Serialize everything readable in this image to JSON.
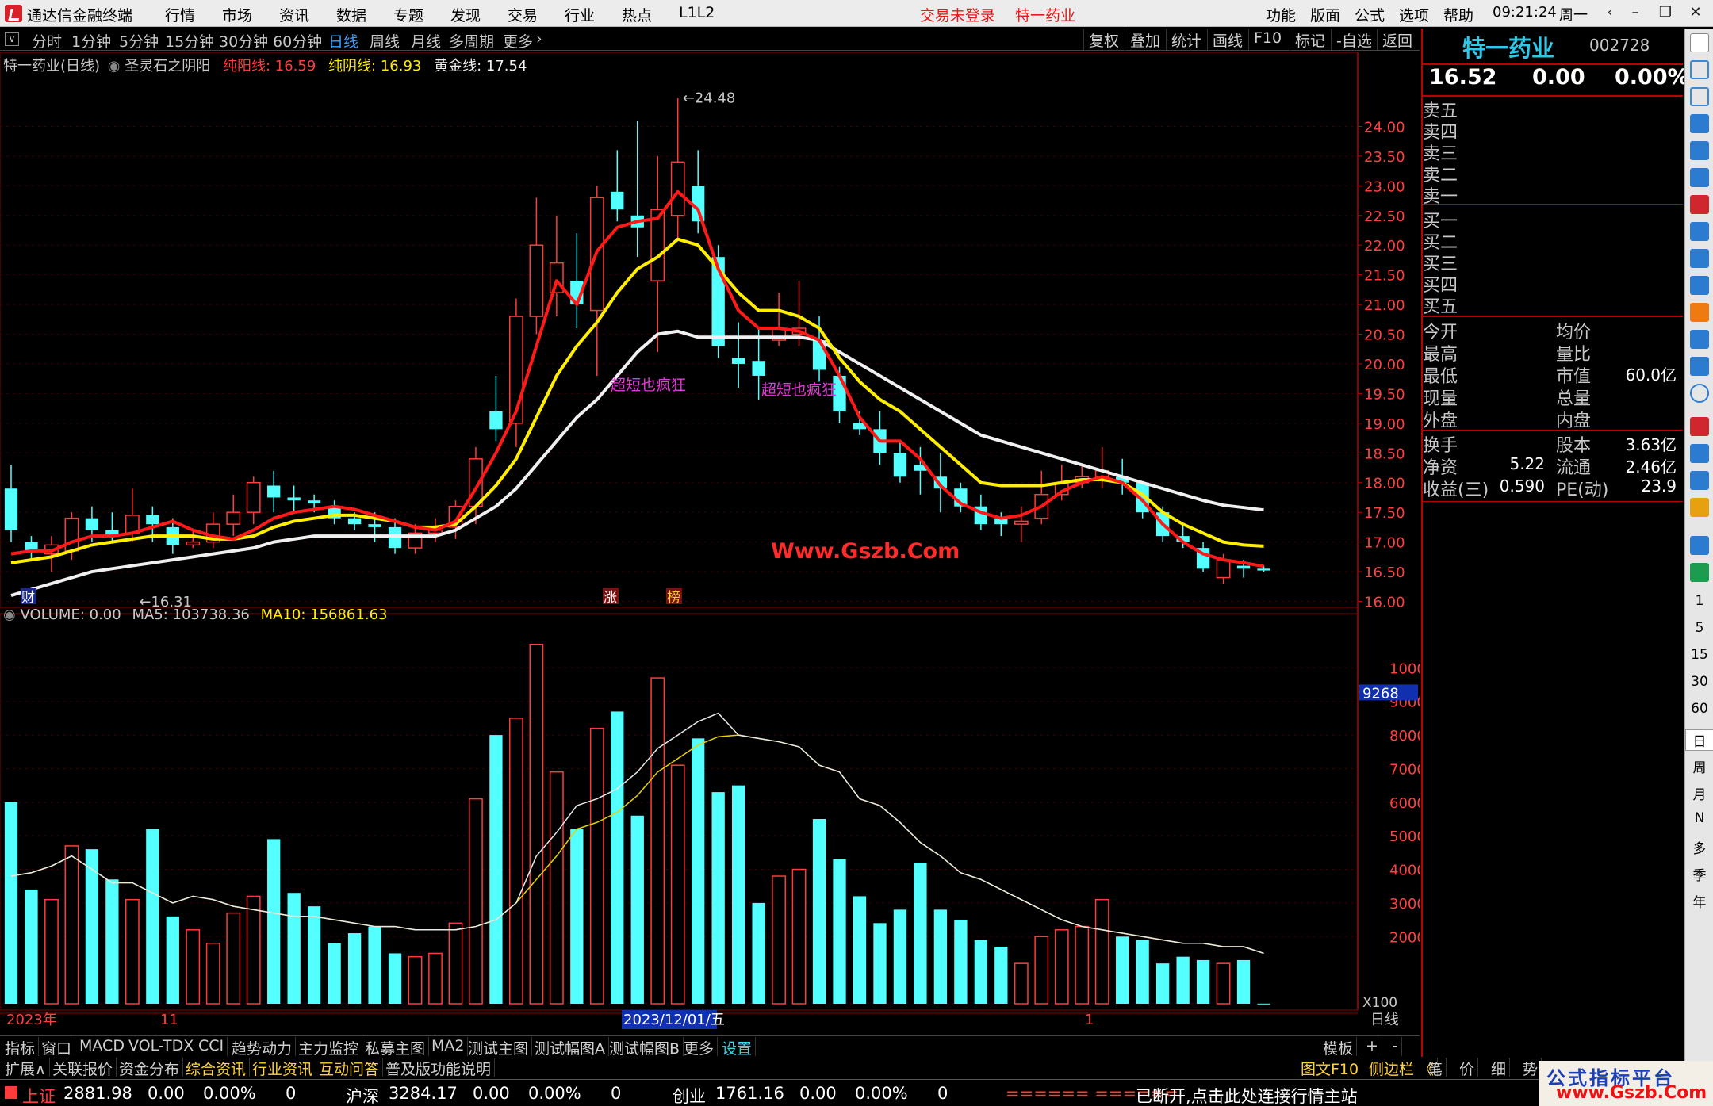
{
  "menubar": {
    "app_title": "通达信金融终端",
    "menus": [
      "行情",
      "市场",
      "资讯",
      "数据",
      "专题",
      "发现",
      "交易",
      "行业",
      "热点",
      "L1L2"
    ],
    "login_status": "交易未登录",
    "stock_title": "特一药业",
    "right_menus": [
      "功能",
      "版面",
      "公式",
      "选项",
      "帮助"
    ],
    "time": "09:21:24",
    "weekday": "周一"
  },
  "periodbar": {
    "periods": [
      "分时",
      "1分钟",
      "5分钟",
      "15分钟",
      "30分钟",
      "60分钟",
      "日线",
      "周线",
      "月线",
      "多周期",
      "更多"
    ],
    "active": "日线",
    "tools": [
      "复权",
      "叠加",
      "统计",
      "画线",
      "F10",
      "标记",
      "-自选",
      "返回"
    ]
  },
  "chart": {
    "title_stock": "特一药业(日线)",
    "indicator_name": "圣灵石之阴阳",
    "pure_yang_label": "纯阳线: 16.59",
    "pure_yin_label": "纯阴线: 16.93",
    "gold_label": "黄金线: 17.54",
    "annotation_1": "超短也疯狂",
    "annotation_2": "超短也疯狂",
    "high_mark": "24.48",
    "low_mark": "16.31",
    "watermark": "Www.Gszb.Com",
    "badges": [
      "财",
      "涨",
      "榜"
    ],
    "price_ticks": [
      "24.00",
      "23.50",
      "23.00",
      "22.50",
      "22.00",
      "21.50",
      "21.00",
      "20.50",
      "20.00",
      "19.50",
      "19.00",
      "18.50",
      "18.00",
      "17.50",
      "17.00",
      "16.50",
      "16.00"
    ],
    "date_labels": [
      "2023年",
      "11",
      "2023/12/01/五",
      "1"
    ],
    "period_label": "日线"
  },
  "volume": {
    "title": "VOLUME: 0.00",
    "ma5_label": "MA5: 103738.36",
    "ma10_label": "MA10: 156861.63",
    "ticks": [
      "10000",
      "9000",
      "8000",
      "7000",
      "6000",
      "5000",
      "4000",
      "3000",
      "2000"
    ],
    "current_tag": "9268",
    "unit": "X100"
  },
  "chart_data": {
    "type": "candlestick",
    "candles": [
      [
        17.9,
        17.2,
        18.3,
        17.0
      ],
      [
        17.0,
        16.85,
        17.1,
        16.7
      ],
      [
        16.8,
        16.95,
        17.1,
        16.5
      ],
      [
        16.85,
        17.4,
        17.5,
        16.7
      ],
      [
        17.4,
        17.2,
        17.6,
        17.0
      ],
      [
        17.2,
        17.1,
        17.5,
        17.0
      ],
      [
        17.15,
        17.45,
        17.9,
        17.0
      ],
      [
        17.45,
        17.3,
        17.6,
        17.0
      ],
      [
        17.25,
        16.95,
        17.4,
        16.8
      ],
      [
        16.95,
        17.0,
        17.2,
        16.9
      ],
      [
        17.0,
        17.3,
        17.5,
        16.9
      ],
      [
        17.3,
        17.5,
        17.8,
        17.1
      ],
      [
        17.5,
        18.0,
        18.1,
        17.3
      ],
      [
        17.95,
        17.75,
        18.2,
        17.5
      ],
      [
        17.75,
        17.7,
        17.95,
        17.5
      ],
      [
        17.7,
        17.65,
        17.8,
        17.5
      ],
      [
        17.6,
        17.4,
        17.7,
        17.3
      ],
      [
        17.4,
        17.3,
        17.5,
        17.2
      ],
      [
        17.3,
        17.25,
        17.5,
        17.0
      ],
      [
        17.25,
        16.9,
        17.4,
        16.8
      ],
      [
        16.9,
        17.15,
        17.3,
        16.8
      ],
      [
        17.15,
        17.2,
        17.4,
        17.0
      ],
      [
        17.25,
        17.6,
        17.7,
        17.05
      ],
      [
        17.6,
        18.4,
        18.6,
        17.3
      ],
      [
        19.2,
        18.9,
        19.8,
        18.7
      ],
      [
        19.0,
        20.8,
        21.1,
        18.6
      ],
      [
        20.8,
        22.0,
        22.8,
        20.5
      ],
      [
        21.2,
        21.7,
        22.5,
        20.8
      ],
      [
        21.4,
        21.0,
        22.2,
        20.6
      ],
      [
        20.9,
        22.8,
        23.0,
        19.8
      ],
      [
        22.9,
        22.6,
        23.6,
        22.4
      ],
      [
        22.5,
        22.3,
        24.1,
        21.8
      ],
      [
        21.4,
        22.6,
        23.5,
        20.2
      ],
      [
        22.5,
        23.4,
        24.48,
        22.1
      ],
      [
        23.0,
        22.4,
        23.6,
        22.2
      ],
      [
        21.8,
        20.3,
        22.0,
        20.1
      ],
      [
        20.1,
        20.0,
        20.7,
        19.6
      ],
      [
        20.05,
        19.8,
        20.6,
        19.4
      ],
      [
        20.4,
        20.6,
        21.2,
        20.3
      ],
      [
        20.5,
        20.6,
        21.4,
        20.3
      ],
      [
        20.4,
        19.9,
        20.8,
        19.7
      ],
      [
        19.8,
        19.2,
        19.95,
        19.0
      ],
      [
        19.0,
        18.9,
        19.2,
        18.8
      ],
      [
        18.9,
        18.5,
        19.2,
        18.3
      ],
      [
        18.5,
        18.1,
        18.7,
        18.0
      ],
      [
        18.3,
        18.2,
        18.6,
        17.8
      ],
      [
        18.1,
        17.9,
        18.5,
        17.5
      ],
      [
        17.9,
        17.6,
        18.0,
        17.5
      ],
      [
        17.6,
        17.3,
        17.8,
        17.2
      ],
      [
        17.4,
        17.3,
        17.5,
        17.1
      ],
      [
        17.3,
        17.35,
        17.6,
        17.0
      ],
      [
        17.4,
        17.8,
        18.2,
        17.3
      ],
      [
        17.8,
        18.0,
        18.3,
        17.7
      ],
      [
        18.0,
        18.1,
        18.3,
        17.9
      ],
      [
        18.1,
        18.2,
        18.6,
        17.9
      ],
      [
        18.1,
        18.0,
        18.4,
        17.8
      ],
      [
        18.0,
        17.5,
        18.0,
        17.4
      ],
      [
        17.5,
        17.1,
        17.6,
        17.0
      ],
      [
        17.1,
        17.0,
        17.3,
        16.9
      ],
      [
        16.9,
        16.55,
        17.0,
        16.5
      ],
      [
        16.4,
        16.7,
        16.8,
        16.3
      ],
      [
        16.6,
        16.55,
        16.7,
        16.4
      ],
      [
        16.55,
        16.52,
        16.6,
        16.5
      ]
    ],
    "volumes": [
      6000,
      3400,
      3100,
      4700,
      4600,
      3700,
      3100,
      5200,
      2600,
      2200,
      1800,
      2700,
      3200,
      4900,
      3300,
      2900,
      1800,
      2100,
      2300,
      1500,
      1400,
      1500,
      2400,
      6100,
      8000,
      8500,
      10700,
      6900,
      5200,
      8200,
      8700,
      5600,
      9700,
      7100,
      7900,
      6300,
      6500,
      3000,
      3800,
      4000,
      5500,
      4300,
      3200,
      2400,
      2800,
      4200,
      2800,
      2500,
      1900,
      1700,
      1200,
      2000,
      2200,
      2300,
      3100,
      2000,
      1900,
      1200,
      1400,
      1300,
      1200,
      1300,
      5
    ],
    "pure_yang_line": [
      16.8,
      16.85,
      16.85,
      17.0,
      17.1,
      17.1,
      17.15,
      17.25,
      17.35,
      17.2,
      17.1,
      17.05,
      17.2,
      17.4,
      17.5,
      17.55,
      17.6,
      17.55,
      17.45,
      17.35,
      17.25,
      17.2,
      17.35,
      17.9,
      18.5,
      19.2,
      20.3,
      21.4,
      21.0,
      21.9,
      22.3,
      22.4,
      22.45,
      22.9,
      22.6,
      21.6,
      20.9,
      20.6,
      20.6,
      20.55,
      20.4,
      19.8,
      19.1,
      18.7,
      18.7,
      18.4,
      17.95,
      17.65,
      17.5,
      17.4,
      17.45,
      17.6,
      17.85,
      18.0,
      18.1,
      18.0,
      17.7,
      17.3,
      17.0,
      16.8,
      16.7,
      16.65,
      16.59
    ],
    "pure_yin_line": [
      16.65,
      16.7,
      16.75,
      16.85,
      16.95,
      17.0,
      17.05,
      17.1,
      17.1,
      17.1,
      17.05,
      17.05,
      17.1,
      17.25,
      17.35,
      17.4,
      17.45,
      17.45,
      17.4,
      17.35,
      17.25,
      17.25,
      17.3,
      17.6,
      17.95,
      18.4,
      19.1,
      19.8,
      20.3,
      20.7,
      21.2,
      21.6,
      21.8,
      22.1,
      22.0,
      21.6,
      21.2,
      20.9,
      20.9,
      20.8,
      20.6,
      20.1,
      19.7,
      19.4,
      19.2,
      18.9,
      18.6,
      18.3,
      18.0,
      17.95,
      17.95,
      17.95,
      18.0,
      18.05,
      18.05,
      18.0,
      17.8,
      17.5,
      17.3,
      17.15,
      17.0,
      16.95,
      16.93
    ],
    "gold_line": [
      16.1,
      16.2,
      16.3,
      16.4,
      16.5,
      16.55,
      16.6,
      16.65,
      16.7,
      16.75,
      16.8,
      16.85,
      16.9,
      17.0,
      17.05,
      17.1,
      17.1,
      17.1,
      17.1,
      17.1,
      17.1,
      17.1,
      17.2,
      17.4,
      17.6,
      17.9,
      18.3,
      18.7,
      19.1,
      19.4,
      19.8,
      20.2,
      20.5,
      20.55,
      20.45,
      20.45,
      20.45,
      20.45,
      20.45,
      20.45,
      20.4,
      20.2,
      20.0,
      19.8,
      19.6,
      19.4,
      19.2,
      19.0,
      18.8,
      18.7,
      18.6,
      18.5,
      18.4,
      18.3,
      18.2,
      18.1,
      18.0,
      17.9,
      17.8,
      17.7,
      17.62,
      17.58,
      17.54
    ],
    "vol_ma5": [
      3800,
      3900,
      4100,
      4400,
      4000,
      3600,
      3600,
      3300,
      3000,
      3200,
      3100,
      2900,
      2800,
      2700,
      2600,
      2600,
      2500,
      2400,
      2300,
      2300,
      2200,
      2200,
      2200,
      2300,
      2500,
      3000,
      3700,
      4400,
      5200,
      5400,
      5700,
      6200,
      6900,
      7300,
      7700,
      7950,
      8000,
      7900,
      7800,
      7650,
      7100,
      6900,
      6100,
      5900,
      5400,
      4800,
      4400,
      3900,
      3700,
      3400,
      3100,
      2800,
      2500,
      2300,
      2200,
      2100,
      2000,
      1900,
      1800,
      1800,
      1700,
      1700,
      1500
    ],
    "vol_ma10": [
      3800,
      3900,
      4100,
      4400,
      4000,
      3600,
      3600,
      3300,
      3000,
      3200,
      3100,
      2900,
      2800,
      2700,
      2600,
      2600,
      2500,
      2400,
      2300,
      2300,
      2200,
      2200,
      2200,
      2300,
      2500,
      3000,
      3700,
      4400,
      5200,
      5400,
      5700,
      6200,
      6900,
      7300,
      7700,
      7950,
      8000,
      7900,
      7800,
      7650,
      7100,
      6900,
      6100,
      5900,
      5400,
      4800,
      4400,
      3900,
      3700,
      3400,
      3100,
      2800,
      2500,
      2300,
      2200,
      2100,
      2000,
      1900,
      1800,
      1800,
      1700,
      1700,
      1500
    ]
  },
  "quote": {
    "name": "特一药业",
    "code": "002728",
    "price": "16.52",
    "change": "0.00",
    "pct": "0.00%",
    "sell_labels": [
      "卖五",
      "卖四",
      "卖三",
      "卖二",
      "卖一"
    ],
    "buy_labels": [
      "买一",
      "买二",
      "买三",
      "买四",
      "买五"
    ],
    "left_fields": [
      "今开",
      "最高",
      "最低",
      "现量",
      "外盘"
    ],
    "right_fields": [
      "均价",
      "量比",
      "市值",
      "总量",
      "内盘"
    ],
    "market_value": "60.0亿",
    "fund_labels_left": [
      "换手",
      "净资",
      "收益(三)"
    ],
    "fund_values_left": [
      "",
      "5.22",
      "0.590"
    ],
    "fund_labels_right": [
      "股本",
      "流通",
      "PE(动)"
    ],
    "fund_values_right": [
      "3.63亿",
      "2.46亿",
      "23.9"
    ]
  },
  "sidebar": {
    "period_items": [
      "1",
      "5",
      "15",
      "30",
      "60",
      "日",
      "周",
      "月",
      "N",
      "多",
      "季",
      "年"
    ]
  },
  "tabbar1": {
    "tabs": [
      "指标",
      "窗口",
      "MACD",
      "VOL-TDX",
      "CCI",
      "趋势动力",
      "主力监控",
      "私募主图",
      "MA2",
      "测试主图",
      "测试幅图A",
      "测试幅图B",
      "更多",
      "设置"
    ],
    "right_items": [
      "模板",
      "+",
      "-"
    ]
  },
  "tabbar2": {
    "tabs": [
      "扩展∧",
      "关联报价",
      "资金分布",
      "综合资讯",
      "行业资讯",
      "互动问答",
      "普及版功能说明"
    ],
    "right_items": [
      "图文F10",
      "侧边栏 《",
      "笔",
      "价",
      "细",
      "势"
    ]
  },
  "statusbar": {
    "sh_name": "上证",
    "sh_val": "2881.98",
    "sh_chg": "0.00",
    "sh_pct": "0.00%",
    "sh_vol": "0",
    "sz_name": "沪深",
    "sz_val": "3284.17",
    "sz_chg": "0.00",
    "sz_pct": "0.00%",
    "sz_vol": "0",
    "cy_name": "创业",
    "cy_val": "1761.16",
    "cy_chg": "0.00",
    "cy_pct": "0.00%",
    "cy_vol": "0",
    "ticker": "====== ======",
    "message": "已断开,点击此处连接行情主站"
  },
  "brand": {
    "line1": "公式指标平台",
    "line2": "www.Gszb.Com"
  },
  "colors": {
    "up": "#ff3b3b",
    "down": "#54ffff",
    "yang_line": "#ff1a1a",
    "yin_line": "#ffee00",
    "gold_line": "#f0f0f0",
    "accent_border": "#b00000"
  }
}
